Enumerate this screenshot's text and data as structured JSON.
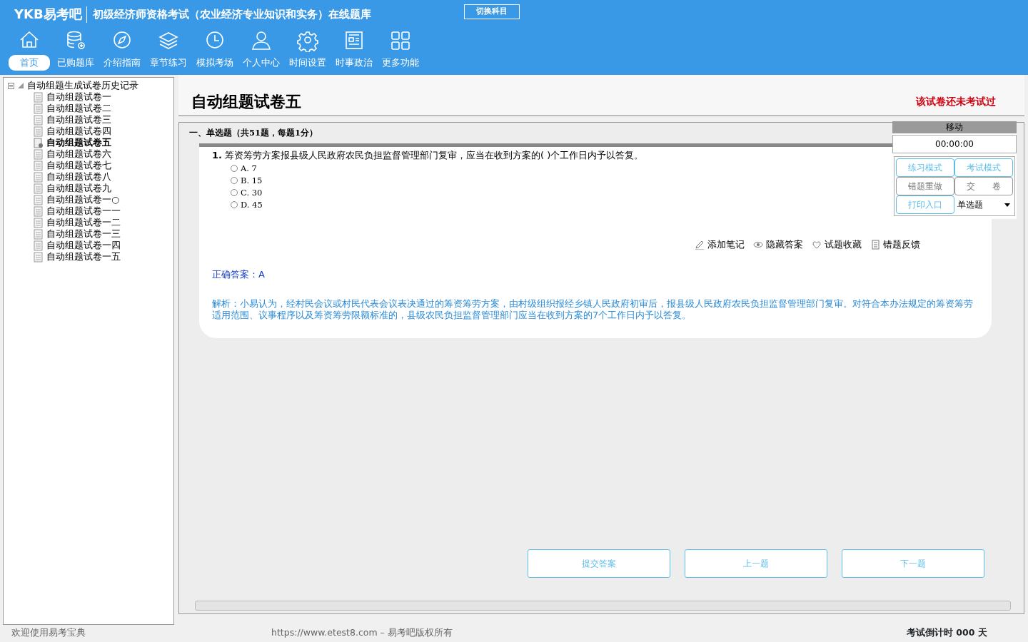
{
  "header": {
    "logo": "YKB易考吧",
    "title": "初级经济师资格考试（农业经济专业知识和实务）在线题库",
    "switch_button": "切换科目"
  },
  "nav": [
    {
      "label": "首页",
      "selected": true
    },
    {
      "label": "已购题库",
      "selected": false
    },
    {
      "label": "介绍指南",
      "selected": false
    },
    {
      "label": "章节练习",
      "selected": false
    },
    {
      "label": "模拟考场",
      "selected": false
    },
    {
      "label": "个人中心",
      "selected": false
    },
    {
      "label": "时间设置",
      "selected": false
    },
    {
      "label": "时事政治",
      "selected": false
    },
    {
      "label": "更多功能",
      "selected": false
    }
  ],
  "tree": {
    "label": "自动组题生成试卷历史记录",
    "expanded": true,
    "children": [
      {
        "label": "自动组题试卷一",
        "selected": false
      },
      {
        "label": "自动组题试卷二",
        "selected": false
      },
      {
        "label": "自动组题试卷三",
        "selected": false
      },
      {
        "label": "自动组题试卷四",
        "selected": false
      },
      {
        "label": "自动组题试卷五",
        "selected": true
      },
      {
        "label": "自动组题试卷六",
        "selected": false
      },
      {
        "label": "自动组题试卷七",
        "selected": false
      },
      {
        "label": "自动组题试卷八",
        "selected": false
      },
      {
        "label": "自动组题试卷九",
        "selected": false
      },
      {
        "label": "自动组题试卷一○",
        "selected": false
      },
      {
        "label": "自动组题试卷一一",
        "selected": false
      },
      {
        "label": "自动组题试卷一二",
        "selected": false
      },
      {
        "label": "自动组题试卷一三",
        "selected": false
      },
      {
        "label": "自动组题试卷一四",
        "selected": false
      },
      {
        "label": "自动组题试卷一五",
        "selected": false
      }
    ]
  },
  "paper": {
    "title": "自动组题试卷五",
    "status_note": "该试卷还未考试过",
    "section_heading": "一、单选题（共51题，每题1分）",
    "question": {
      "number": "1.",
      "text": "筹资筹劳方案报县级人民政府农民负担监督管理部门复审，应当在收到方案的( )个工作日内予以答复。",
      "options": [
        {
          "label": "A. 7",
          "selected": false
        },
        {
          "label": "B. 15",
          "selected": false
        },
        {
          "label": "C. 30",
          "selected": false
        },
        {
          "label": "D. 45",
          "selected": false
        }
      ]
    },
    "actions": [
      "添加笔记",
      "隐藏答案",
      "试题收藏",
      "错题反馈"
    ],
    "answer": "正确答案：A",
    "explanation": "解析：小易认为，经村民会议或村民代表会议表决通过的筹资筹劳方案，由村级组织报经乡镇人民政府初审后，报县级人民政府农民负担监督管理部门复审。对符合本办法规定的筹资筹劳适用范围、议事程序以及筹资筹劳限额标准的，县级农民负担监督管理部门应当在收到方案的7个工作日内予以答复。"
  },
  "side_panel": {
    "header": "移动",
    "timer": "00:00:00",
    "buttons": [
      {
        "label": "练习模式",
        "kind": "mode"
      },
      {
        "label": "考试模式",
        "kind": "mode"
      },
      {
        "label": "错题重做",
        "kind": "plain"
      },
      {
        "label": "交　　卷",
        "kind": "plain"
      },
      {
        "label": "打印入口",
        "kind": "mode"
      }
    ],
    "select": "单选题"
  },
  "bottom_buttons": [
    "提交答案",
    "上一题",
    "下一题"
  ],
  "status_bar": {
    "welcome": "欢迎使用易考宝典",
    "copyright": "https://www.etest8.com – 易考吧版权所有",
    "countdown": "考试倒计时 000 天"
  }
}
